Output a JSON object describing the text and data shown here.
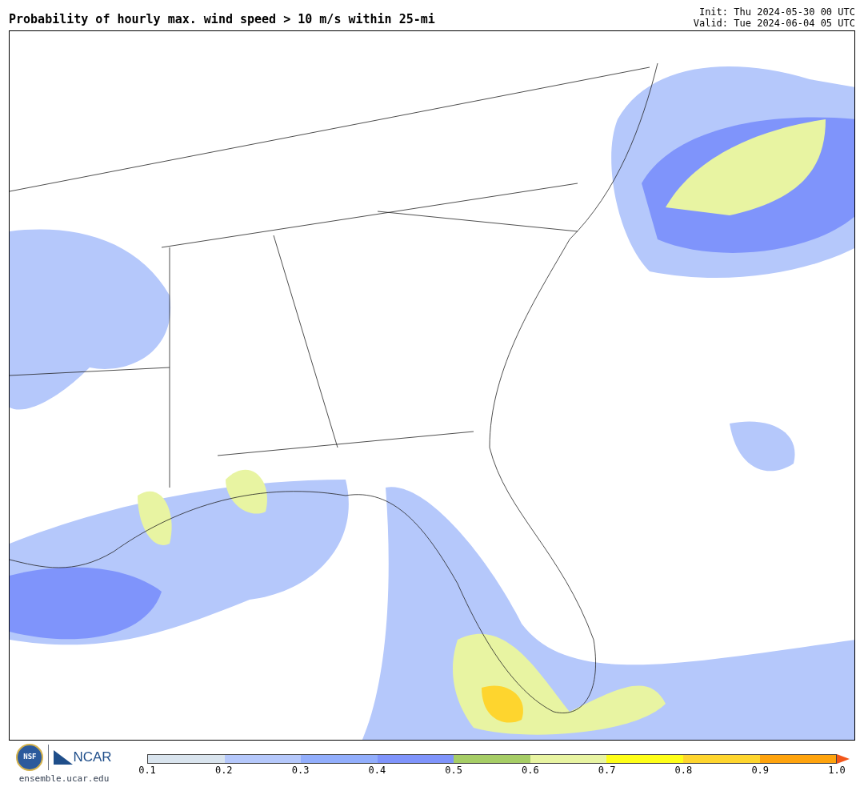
{
  "title": "Probability of hourly max. wind speed > 10 m/s within 25-mi",
  "init": "Init: Thu 2024-05-30 00 UTC",
  "valid": "Valid: Tue 2024-06-04 05 UTC",
  "logos": {
    "nsf": "NSF",
    "ncar": "NCAR",
    "url": "ensemble.ucar.edu"
  },
  "colorbar": {
    "bins": [
      {
        "color": "#d9e4ee"
      },
      {
        "color": "#b5c8fb"
      },
      {
        "color": "#92aefc"
      },
      {
        "color": "#7f94fb"
      },
      {
        "color": "#a6cd66"
      },
      {
        "color": "#e8f4a2"
      },
      {
        "color": "#fefe18"
      },
      {
        "color": "#fed52e"
      },
      {
        "color": "#fea30d"
      }
    ],
    "extend": {
      "color": "#f2561a"
    },
    "ticks": [
      "0.1",
      "0.2",
      "0.3",
      "0.4",
      "0.5",
      "0.6",
      "0.7",
      "0.8",
      "0.9",
      "1.0"
    ]
  }
}
